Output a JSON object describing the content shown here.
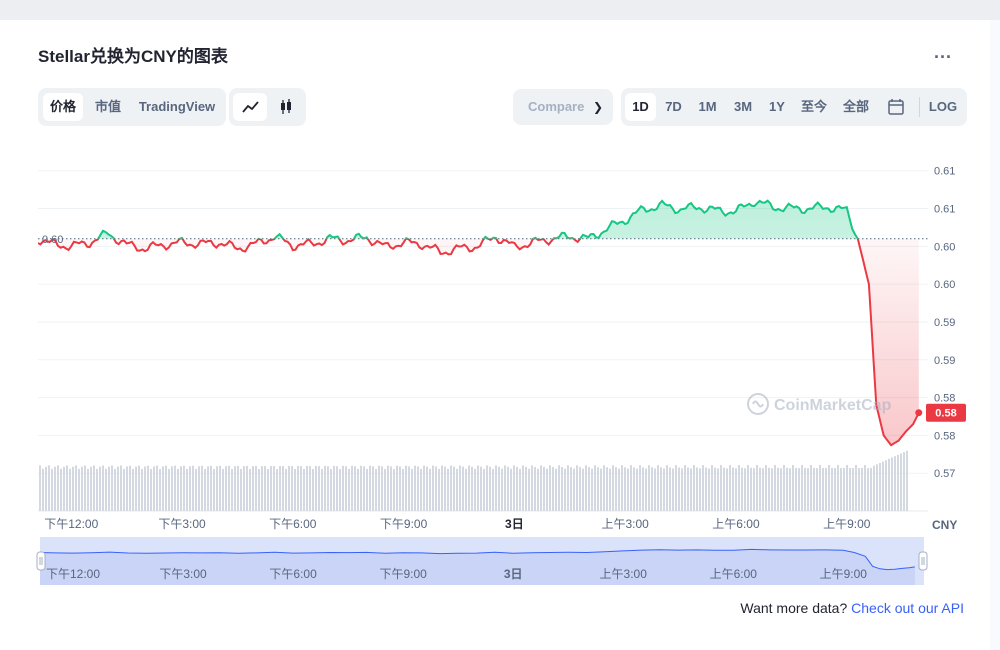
{
  "page": {
    "title": "Stellar兑换为CNY的图表",
    "more_label": "...",
    "view_tabs": [
      "价格",
      "市值",
      "TradingView"
    ],
    "chart_type_icons": [
      "line-chart-icon",
      "candlestick-icon"
    ],
    "compare_label": "Compare",
    "range_tabs": [
      "1D",
      "7D",
      "1M",
      "3M",
      "1Y",
      "至今",
      "全部"
    ],
    "calendar_icon": "calendar-icon",
    "log_label": "LOG",
    "api_text": "Want more data?",
    "api_link": "Check out our API",
    "watermark": "CoinMarketCap",
    "currency_label": "CNY"
  },
  "colors": {
    "up": "#16c784",
    "down": "#ea3943",
    "accent": "#3861fb",
    "navigator_fill": "#dbe3fb"
  },
  "chart_data": {
    "type": "line",
    "title": "",
    "open_price": 0.6035,
    "open_price_label": "0.60",
    "current_price_label": "0.58",
    "y_tick_labels": [
      "0.61",
      "0.61",
      "0.60",
      "0.60",
      "0.59",
      "0.59",
      "0.58",
      "0.58",
      "0.57"
    ],
    "y_tick_values": [
      0.6125,
      0.6075,
      0.6025,
      0.5975,
      0.5925,
      0.5875,
      0.5825,
      0.5775,
      0.5725
    ],
    "ylim": [
      0.5675,
      0.6155
    ],
    "x_tick_labels": [
      "下午12:00",
      "下午3:00",
      "下午6:00",
      "下午9:00",
      "3日",
      "上午3:00",
      "上午6:00",
      "上午9:00"
    ],
    "x_tick_hours": [
      0,
      3,
      6,
      9,
      12,
      15,
      18,
      21
    ],
    "xlim_hours": [
      -0.9,
      23.2
    ],
    "x": [
      -0.9,
      -0.5,
      0,
      0.5,
      1,
      1.5,
      2,
      2.5,
      3,
      3.5,
      4,
      4.5,
      5,
      5.5,
      6,
      6.5,
      7,
      7.5,
      8,
      8.5,
      9,
      9.5,
      10,
      10.5,
      11,
      11.5,
      12,
      12.5,
      13,
      13.5,
      14,
      14.5,
      15,
      15.5,
      16,
      16.5,
      17,
      17.5,
      18,
      18.5,
      19,
      19.5,
      20,
      20.5,
      21,
      21.3,
      21.6,
      21.8,
      22.0,
      22.2,
      22.4,
      22.6,
      22.8,
      22.95
    ],
    "y": [
      0.6035,
      0.6028,
      0.6025,
      0.603,
      0.6042,
      0.6027,
      0.6022,
      0.6027,
      0.603,
      0.6028,
      0.603,
      0.6022,
      0.6028,
      0.6038,
      0.6026,
      0.6028,
      0.6035,
      0.6033,
      0.6037,
      0.6024,
      0.603,
      0.6028,
      0.6017,
      0.6022,
      0.6025,
      0.6038,
      0.6024,
      0.603,
      0.6035,
      0.6038,
      0.6035,
      0.6048,
      0.606,
      0.6074,
      0.6079,
      0.6074,
      0.6077,
      0.6072,
      0.6071,
      0.6085,
      0.6077,
      0.6075,
      0.6075,
      0.6077,
      0.6072,
      0.6035,
      0.5975,
      0.5815,
      0.5775,
      0.5762,
      0.5768,
      0.578,
      0.579,
      0.5805
    ],
    "volume_label": ""
  }
}
